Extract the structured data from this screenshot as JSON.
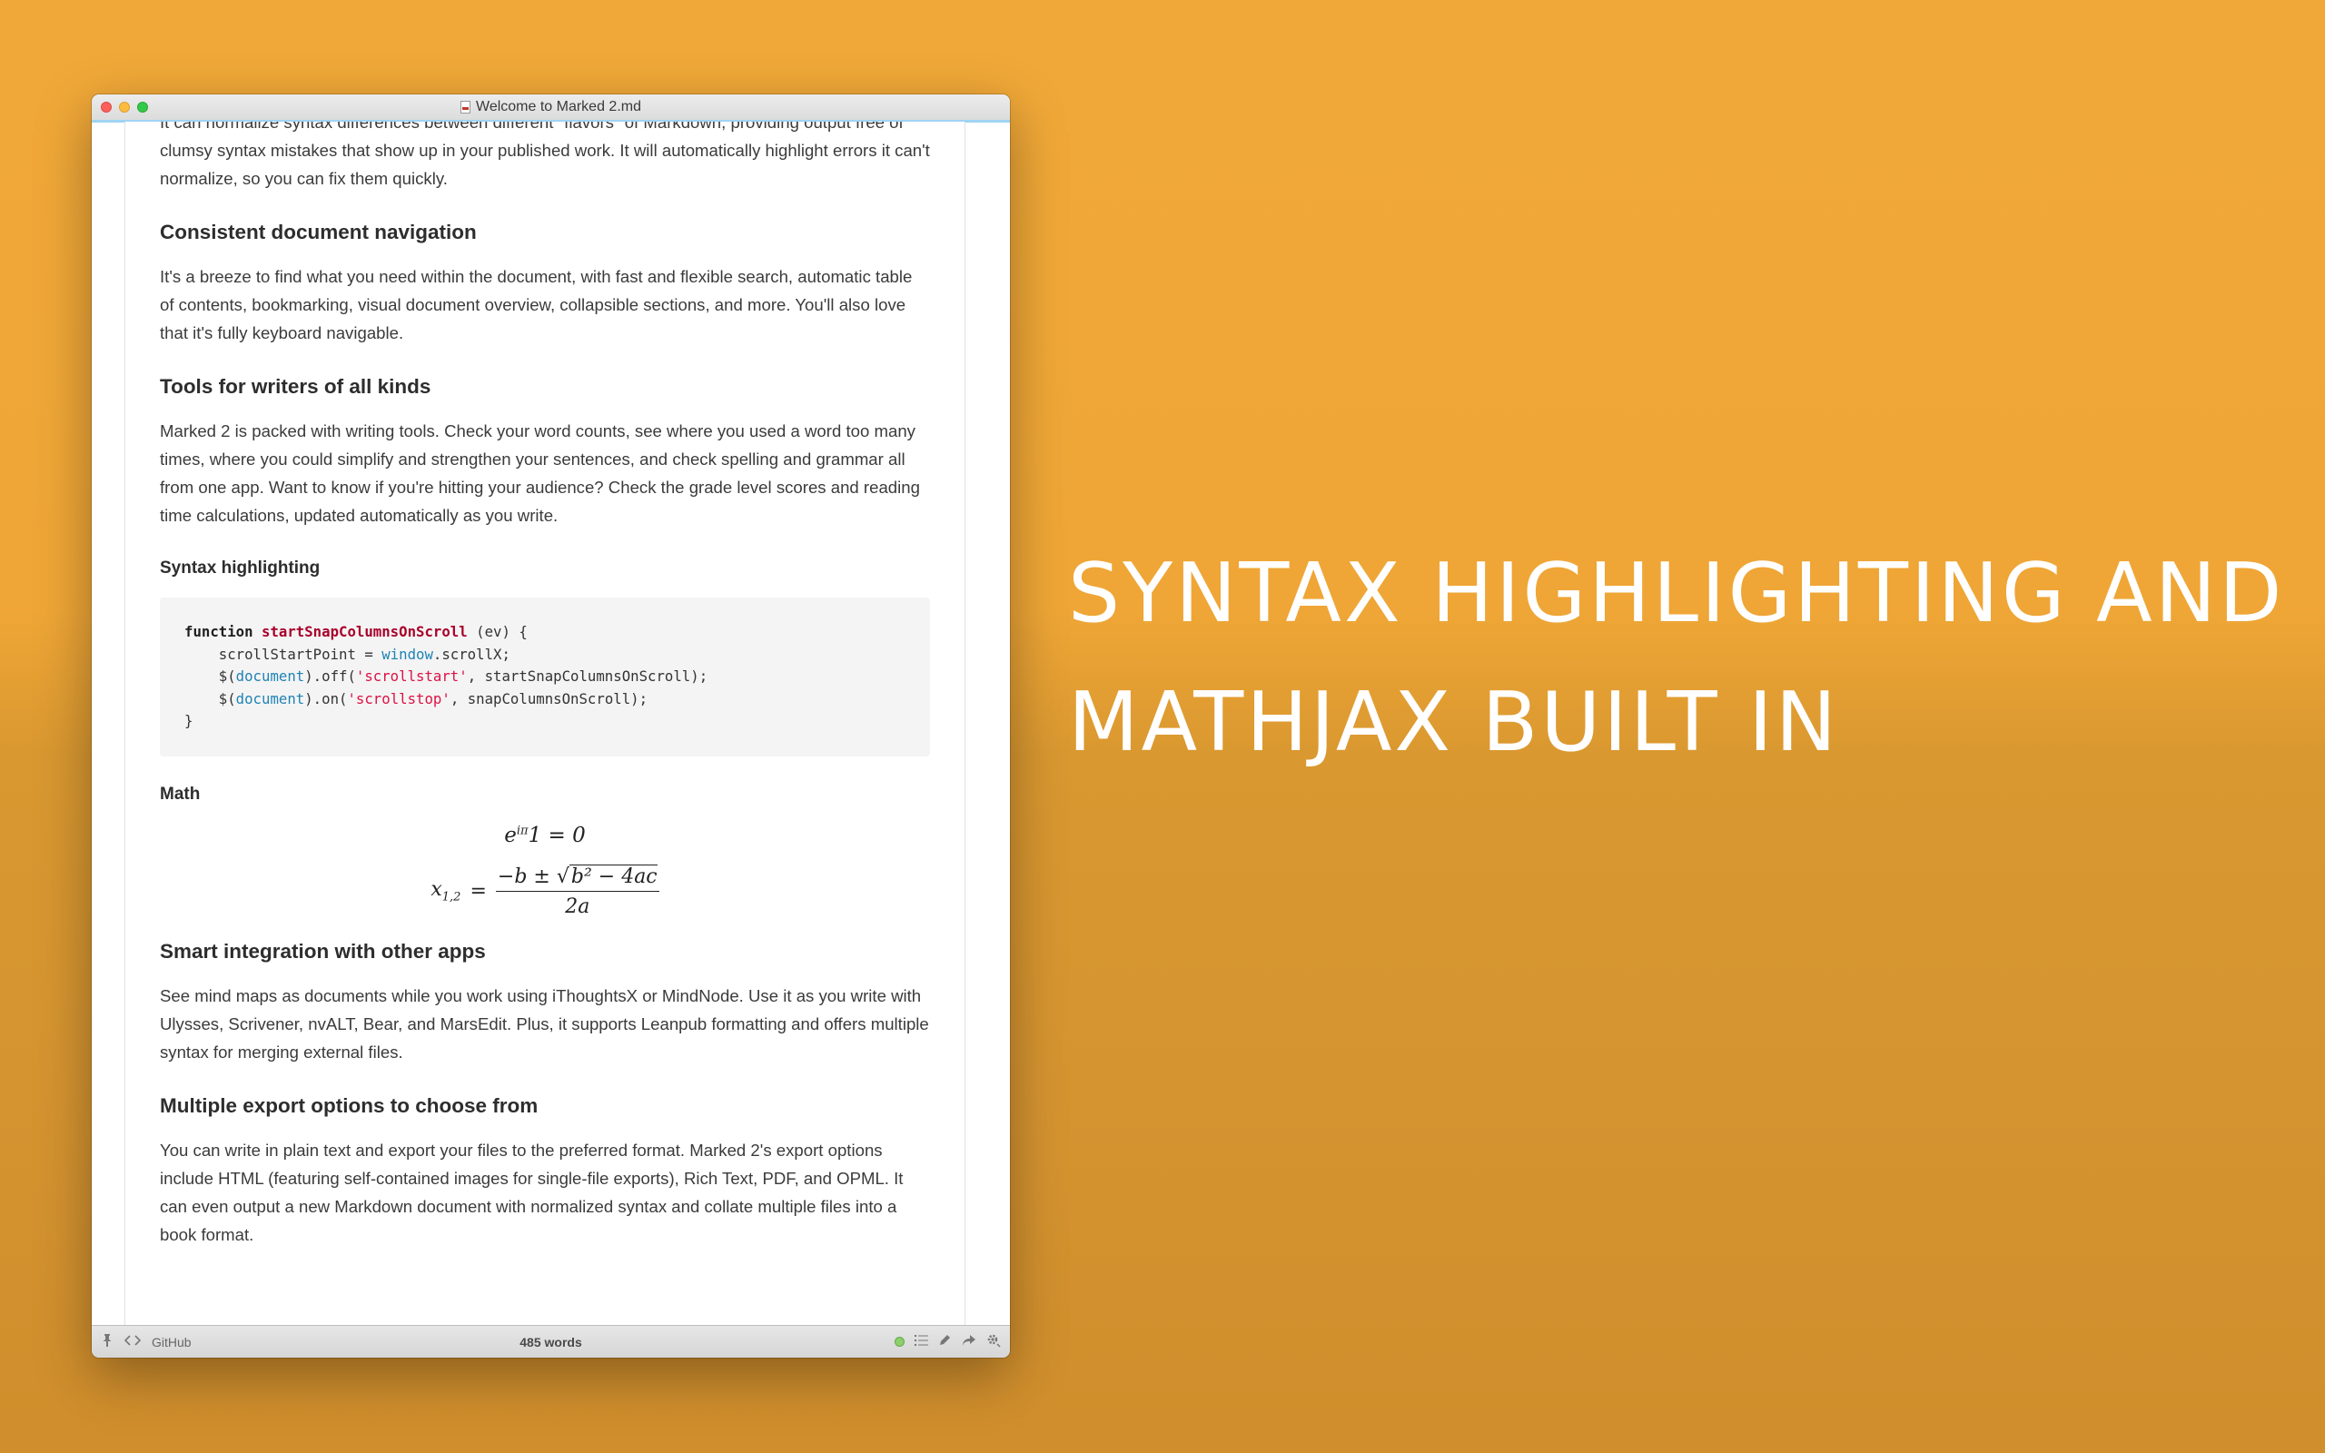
{
  "window": {
    "title": "Welcome to Marked 2.md"
  },
  "document": {
    "intro_paragraph": "It can normalize syntax differences between different \"flavors\" of Markdown, providing output free of clumsy syntax mistakes that show up in your published work. It will automatically highlight errors it can't normalize, so you can fix them quickly.",
    "sections": [
      {
        "heading": "Consistent document navigation",
        "body": "It's a breeze to find what you need within the document, with fast and flexible search, automatic table of contents, bookmarking, visual document overview, collapsible sections, and more. You'll also love that it's fully keyboard navigable."
      },
      {
        "heading": "Tools for writers of all kinds",
        "body": "Marked 2 is packed with writing tools. Check your word counts, see where you used a word too many times, where you could simplify and strengthen your sentences, and check spelling and grammar all from one app. Want to know if you're hitting your audience? Check the grade level scores and reading time calculations, updated automatically as you write."
      },
      {
        "heading": "Smart integration with other apps",
        "body": "See mind maps as documents while you work using iThoughtsX or MindNode. Use it as you write with Ulysses, Scrivener, nvALT, Bear, and MarsEdit. Plus, it supports Leanpub formatting and offers multiple syntax for merging external files."
      },
      {
        "heading": "Multiple export options to choose from",
        "body": "You can write in plain text and export your files to the preferred format. Marked 2's export options include HTML (featuring self-contained images for single-file exports), Rich Text, PDF, and OPML. It can even output a new Markdown document with normalized syntax and collate multiple files into a book format."
      }
    ],
    "syntax_heading": "Syntax highlighting",
    "code": {
      "kw_function": "function",
      "fn_name": "startSnapColumnsOnScroll",
      "params": " (ev) {",
      "l2a": "    scrollStartPoint = ",
      "l2obj": "window",
      "l2b": ".scrollX;",
      "l3a": "    $(",
      "l3obj": "document",
      "l3b": ").off(",
      "l3str": "'scrollstart'",
      "l3c": ", startSnapColumnsOnScroll);",
      "l4a": "    $(",
      "l4obj": "document",
      "l4b": ").on(",
      "l4str": "'scrollstop'",
      "l4c": ", snapColumnsOnScroll);",
      "l5": "}"
    },
    "math_heading": "Math",
    "math": {
      "eq1_base": "e",
      "eq1_exp": "iπ",
      "eq1_rest": "1 = 0",
      "eq2_lhs": "x",
      "eq2_sub": "1,2",
      "eq2_eq": "=",
      "eq2_num_pre": "−b ± ",
      "eq2_root": "b² − 4ac",
      "eq2_den": "2a"
    }
  },
  "statusbar": {
    "style_name": "GitHub",
    "word_count": "485 words"
  },
  "headline": {
    "line1": "SYNTAX  HIGHLIGHTING AND",
    "line2": "MATHJAX  BUILT IN"
  },
  "colors": {
    "background": "#efa636",
    "accent_progress": "#9fd3f4",
    "code_function": "#a8002a",
    "code_object": "#1f83b3",
    "code_string": "#dd1144"
  }
}
